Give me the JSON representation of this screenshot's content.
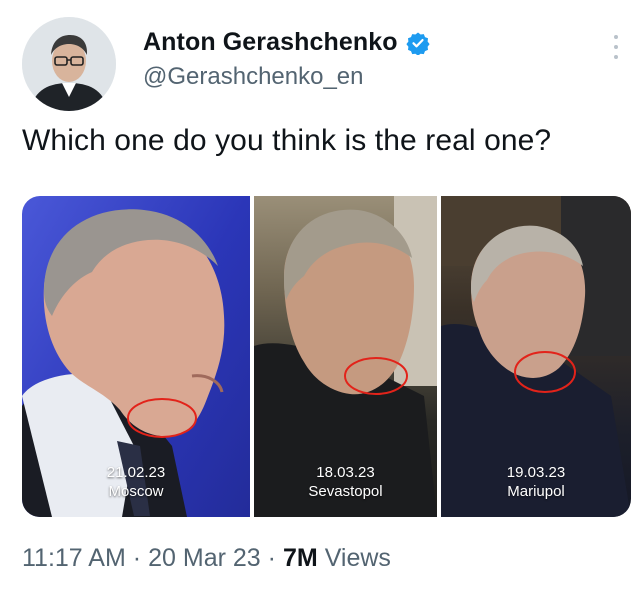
{
  "author": {
    "display_name": "Anton Gerashchenko",
    "handle": "@Gerashchenko_en",
    "verified_icon": "verified-badge-icon",
    "verified_color": "#1d9bf0"
  },
  "tweet": {
    "text": "Which one do you think is the real one?"
  },
  "media": {
    "panels": [
      {
        "date": "21.02.23",
        "place": "Moscow"
      },
      {
        "date": "18.03.23",
        "place": "Sevastopol"
      },
      {
        "date": "19.03.23",
        "place": "Mariupol"
      }
    ],
    "circle_color": "#e2231a"
  },
  "meta": {
    "time": "11:17 AM",
    "date": "20 Mar 23",
    "separator": "·",
    "views_count": "7M",
    "views_label": "Views"
  }
}
